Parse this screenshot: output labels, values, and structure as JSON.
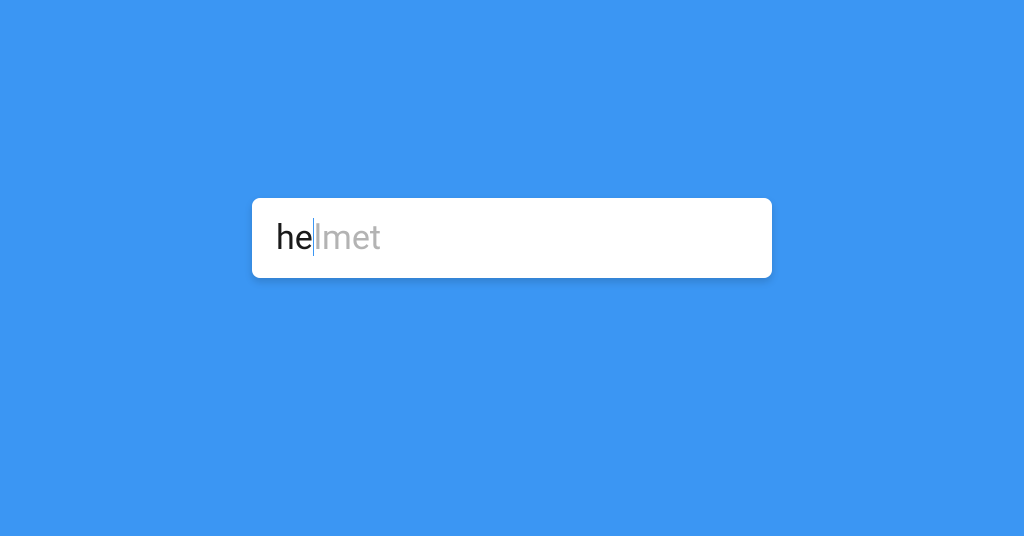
{
  "search": {
    "typed": "he",
    "suggestion_remainder": "lmet",
    "full_suggestion": "helmet"
  },
  "colors": {
    "background": "#3b96f3",
    "input_bg": "#ffffff",
    "typed_text": "#1a1a1a",
    "suggestion_text": "#b3b3b3",
    "cursor": "#3b96f3"
  }
}
